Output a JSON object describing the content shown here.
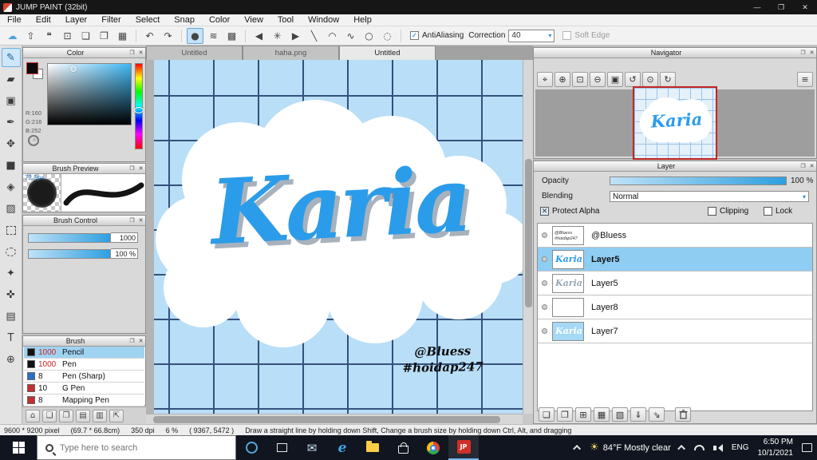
{
  "window": {
    "title": "JUMP PAINT (32bit)"
  },
  "menu": {
    "items": [
      "File",
      "Edit",
      "Layer",
      "Filter",
      "Select",
      "Snap",
      "Color",
      "View",
      "Tool",
      "Window",
      "Help"
    ]
  },
  "toolbar": {
    "antialiasing": "AntiAliasing",
    "correction": "Correction",
    "correction_value": "40",
    "soft_edge": "Soft Edge"
  },
  "panels": {
    "color": {
      "title": "Color",
      "r": "R:160",
      "g": "G:216",
      "b": "B:252"
    },
    "brush_preview": {
      "title": "Brush Preview",
      "size": "72.5px"
    },
    "brush_control": {
      "title": "Brush Control",
      "size_value": "1000",
      "opacity_value": "100 %"
    },
    "brush": {
      "title": "Brush",
      "items": [
        {
          "size": "1000",
          "name": "Pencil"
        },
        {
          "size": "1000",
          "name": "Pen"
        },
        {
          "size": "8",
          "name": "Pen (Sharp)"
        },
        {
          "size": "10",
          "name": "G Pen"
        },
        {
          "size": "8",
          "name": "Mapping Pen"
        }
      ]
    },
    "navigator": {
      "title": "Navigator"
    },
    "layer": {
      "title": "Layer",
      "opacity_label": "Opacity",
      "opacity_value": "100 %",
      "blending_label": "Blending",
      "blending_value": "Normal",
      "protect_alpha": "Protect Alpha",
      "clipping": "Clipping",
      "lock": "Lock",
      "layers": [
        {
          "name": "@Bluess"
        },
        {
          "name": "Layer5"
        },
        {
          "name": "Layer5"
        },
        {
          "name": "Layer8"
        },
        {
          "name": "Layer7"
        }
      ]
    }
  },
  "canvas": {
    "tabs": [
      "Untitled",
      "haha.png",
      "Untitled"
    ],
    "artwork_text": "Karia",
    "watermark1": "@Bluess",
    "watermark2": "#hoidap247"
  },
  "status_bar": {
    "dimensions": "9600 * 9200 pixel",
    "size_cm": "(69.7 * 66.8cm)",
    "dpi": "350 dpi",
    "zoom": "6 %",
    "cursor": "( 9367, 5472 )",
    "hint": "Draw a straight line by holding down Shift, Change a brush size by holding down Ctrl, Alt, and dragging"
  },
  "taskbar": {
    "search_placeholder": "Type here to search",
    "weather": "84°F Mostly clear",
    "language": "ENG",
    "time": "6:50 PM",
    "date": "10/1/2021"
  },
  "colors": {
    "accent": "#2b9ce9",
    "selection": "#8fcdf3",
    "canvas_bg": "#b9def7",
    "grid": "#33517c"
  }
}
